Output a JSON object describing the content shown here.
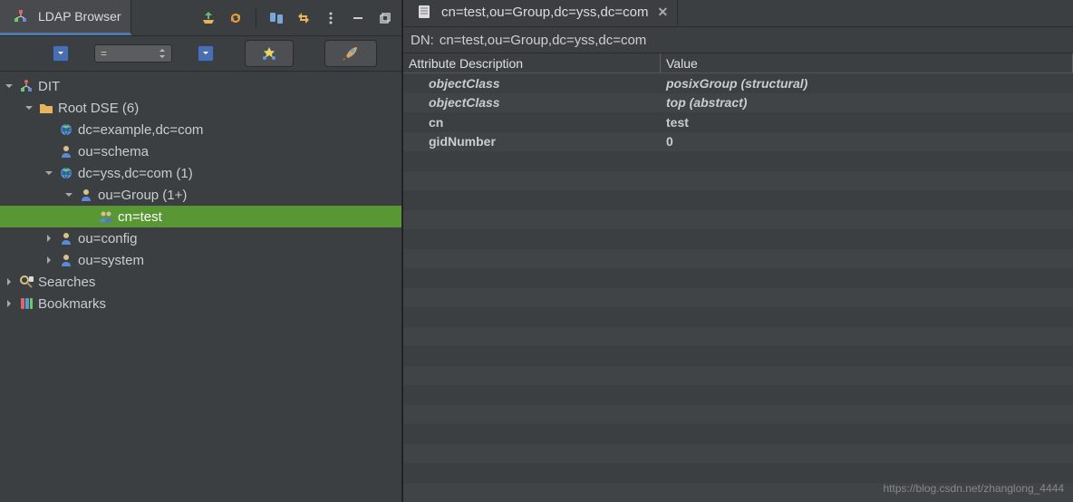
{
  "left": {
    "tab_title": "LDAP Browser",
    "filter_eq": "=",
    "tree": [
      {
        "depth": 0,
        "arrow": "v",
        "icon": "dit",
        "label": "DIT",
        "name": "dit-root"
      },
      {
        "depth": 1,
        "arrow": "v",
        "icon": "folder",
        "label": "Root DSE (6)",
        "name": "root-dse"
      },
      {
        "depth": 2,
        "arrow": "",
        "icon": "globe",
        "label": "dc=example,dc=com",
        "name": "dc-example"
      },
      {
        "depth": 2,
        "arrow": "",
        "icon": "person",
        "label": "ou=schema",
        "name": "ou-schema"
      },
      {
        "depth": 2,
        "arrow": "v",
        "icon": "globe",
        "label": "dc=yss,dc=com (1)",
        "name": "dc-yss"
      },
      {
        "depth": 3,
        "arrow": "v",
        "icon": "person",
        "label": "ou=Group (1+)",
        "name": "ou-group"
      },
      {
        "depth": 4,
        "arrow": "",
        "icon": "people",
        "label": "cn=test",
        "name": "cn-test",
        "selected": true
      },
      {
        "depth": 2,
        "arrow": ">",
        "icon": "person",
        "label": "ou=config",
        "name": "ou-config"
      },
      {
        "depth": 2,
        "arrow": ">",
        "icon": "person",
        "label": "ou=system",
        "name": "ou-system"
      },
      {
        "depth": 0,
        "arrow": ">",
        "icon": "search",
        "label": "Searches",
        "name": "searches"
      },
      {
        "depth": 0,
        "arrow": ">",
        "icon": "bookmark",
        "label": "Bookmarks",
        "name": "bookmarks"
      }
    ]
  },
  "right": {
    "tab_title": "cn=test,ou=Group,dc=yss,dc=com",
    "dn_label": "DN:",
    "dn_value": "cn=test,ou=Group,dc=yss,dc=com",
    "headers": {
      "attr": "Attribute Description",
      "value": "Value"
    },
    "rows": [
      {
        "attr": "objectClass",
        "val": "posixGroup (structural)",
        "italic": true
      },
      {
        "attr": "objectClass",
        "val": "top (abstract)",
        "italic": true
      },
      {
        "attr": "cn",
        "val": "test",
        "italic": false
      },
      {
        "attr": "gidNumber",
        "val": "0",
        "italic": false
      }
    ],
    "blank_rows": 18
  },
  "watermark": "https://blog.csdn.net/zhanglong_4444"
}
